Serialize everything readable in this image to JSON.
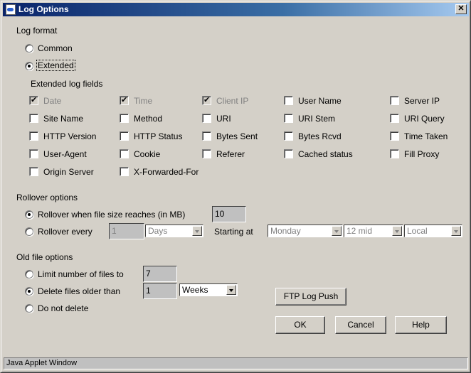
{
  "window": {
    "title": "Log Options",
    "close_label": "✕",
    "status": "Java Applet Window"
  },
  "log_format": {
    "heading": "Log format",
    "common": "Common",
    "extended": "Extended",
    "selected": "extended",
    "fields_heading": "Extended log fields",
    "fields": [
      {
        "label": "Date",
        "checked": true,
        "disabled": true
      },
      {
        "label": "Time",
        "checked": true,
        "disabled": true
      },
      {
        "label": "Client IP",
        "checked": true,
        "disabled": true
      },
      {
        "label": "User Name",
        "checked": false
      },
      {
        "label": "Server IP",
        "checked": false
      },
      {
        "label": "Site Name",
        "checked": false
      },
      {
        "label": "Method",
        "checked": false
      },
      {
        "label": "URI",
        "checked": false
      },
      {
        "label": "URI Stem",
        "checked": false
      },
      {
        "label": "URI Query",
        "checked": false
      },
      {
        "label": "HTTP Version",
        "checked": false
      },
      {
        "label": "HTTP Status",
        "checked": false
      },
      {
        "label": "Bytes Sent",
        "checked": false
      },
      {
        "label": "Bytes Rcvd",
        "checked": false
      },
      {
        "label": "Time Taken",
        "checked": false
      },
      {
        "label": "User-Agent",
        "checked": false
      },
      {
        "label": "Cookie",
        "checked": false
      },
      {
        "label": "Referer",
        "checked": false
      },
      {
        "label": "Cached status",
        "checked": false
      },
      {
        "label": "Fill Proxy",
        "checked": false
      },
      {
        "label": "Origin Server",
        "checked": false
      },
      {
        "label": "X-Forwarded-For",
        "checked": false
      }
    ]
  },
  "rollover": {
    "heading": "Rollover options",
    "size_label": "Rollover when file size reaches (in MB)",
    "size_value": "10",
    "every_label": "Rollover every",
    "every_value": "1",
    "every_unit": "Days",
    "starting_label": "Starting at",
    "day": "Monday",
    "time": "12 mid",
    "zone": "Local"
  },
  "old_files": {
    "heading": "Old file options",
    "limit_label": "Limit number of files to",
    "limit_value": "7",
    "delete_label": "Delete files older than",
    "delete_value": "1",
    "delete_unit": "Weeks",
    "none_label": "Do not delete"
  },
  "buttons": {
    "ftp": "FTP Log Push",
    "ok": "OK",
    "cancel": "Cancel",
    "help": "Help"
  }
}
